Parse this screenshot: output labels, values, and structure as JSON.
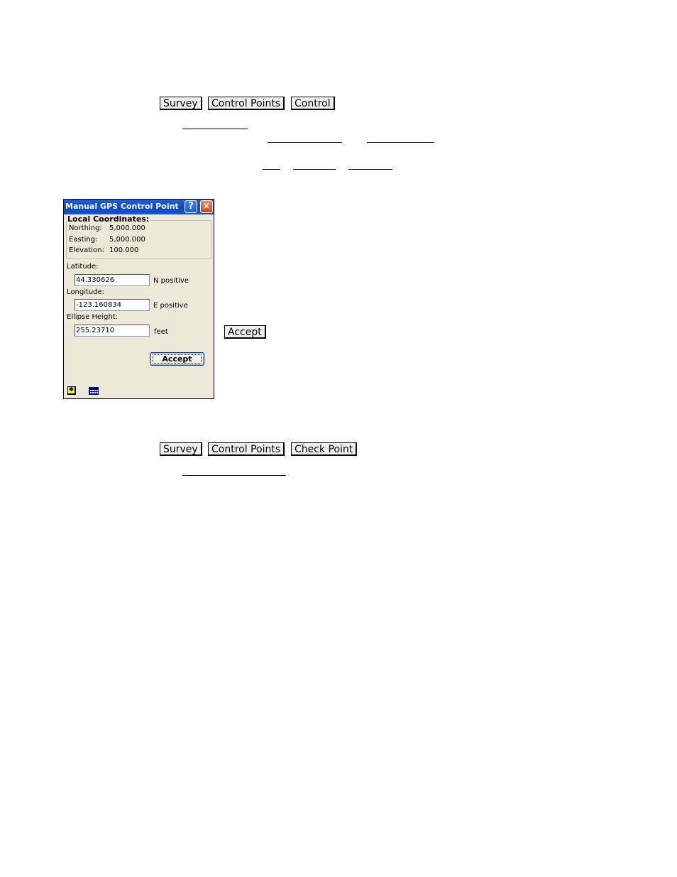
{
  "section1": {
    "breadcrumb": [
      "Survey",
      "Control Points",
      "Control"
    ]
  },
  "dialog": {
    "title": "Manual GPS Control Point",
    "help_label": "?",
    "close_label": "×",
    "local_coordinates": {
      "heading": "Local Coordinates:",
      "rows": [
        {
          "label": "Northing:",
          "value": "5,000.000"
        },
        {
          "label": "Easting:",
          "value": "5,000.000"
        },
        {
          "label": "Elevation:",
          "value": "100.000"
        }
      ]
    },
    "latitude": {
      "label": "Latitude:",
      "value": "44.330626",
      "unit": "N positive"
    },
    "longitude": {
      "label": "Longitude:",
      "value": "-123.160834",
      "unit": "E positive"
    },
    "ellipse_height": {
      "label": "Ellipse Height:",
      "value": "255.23710",
      "unit": "feet"
    },
    "accept_label": "Accept",
    "icons": [
      "sun-settings-icon",
      "grid-table-icon"
    ]
  },
  "side_button": {
    "label": "Accept"
  },
  "section2": {
    "breadcrumb": [
      "Survey",
      "Control Points",
      "Check Point"
    ]
  }
}
